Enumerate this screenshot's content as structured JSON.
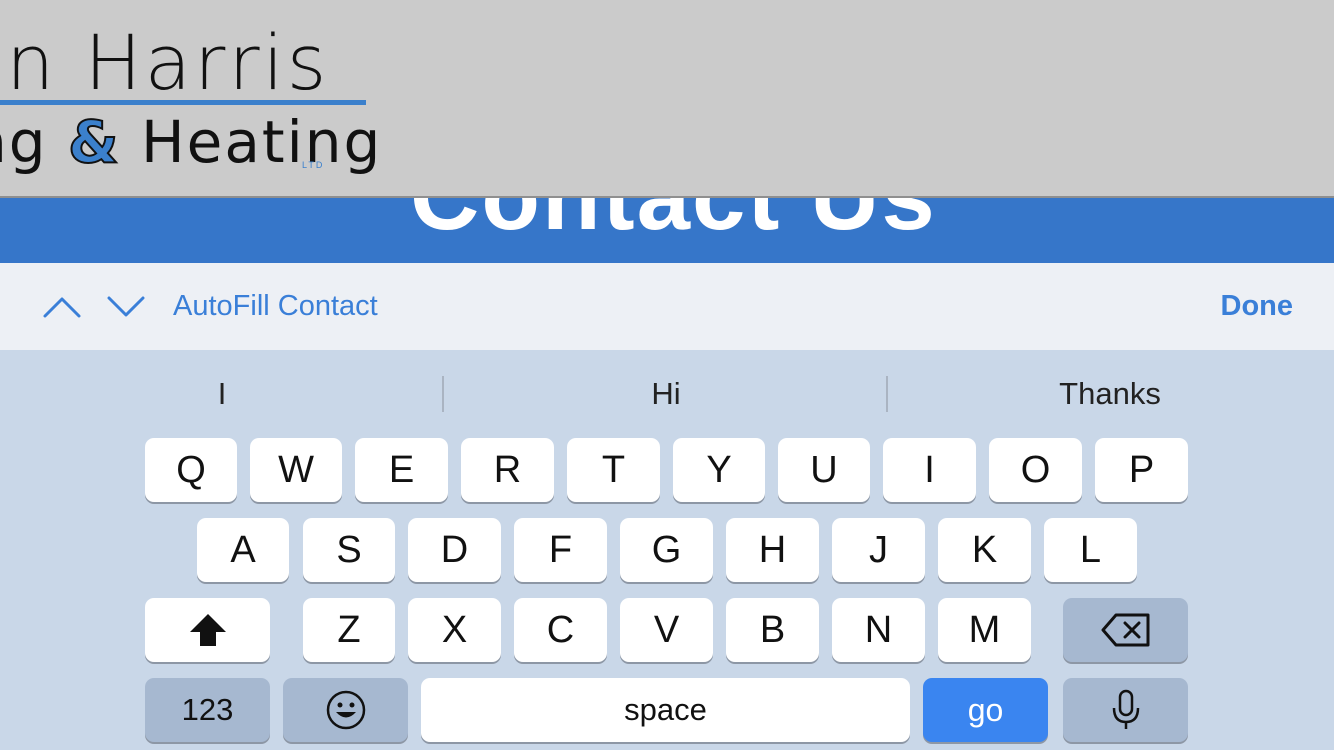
{
  "web_page": {
    "logo": {
      "line1": "in Harris",
      "line2_part_a": "ng ",
      "line2_amp": "&",
      "line2_part_b": " Heating",
      "ltd": "LTD"
    },
    "section_title": "Contact Us"
  },
  "accessory_bar": {
    "autofill_label": "AutoFill Contact",
    "done_label": "Done"
  },
  "keyboard": {
    "predictions": [
      "I",
      "Hi",
      "Thanks"
    ],
    "row1": [
      "Q",
      "W",
      "E",
      "R",
      "T",
      "Y",
      "U",
      "I",
      "O",
      "P"
    ],
    "row2": [
      "A",
      "S",
      "D",
      "F",
      "G",
      "H",
      "J",
      "K",
      "L"
    ],
    "row3": [
      "Z",
      "X",
      "C",
      "V",
      "B",
      "N",
      "M"
    ],
    "numbers_label": "123",
    "space_label": "space",
    "go_label": "go"
  },
  "colors": {
    "accent": "#3a7fd8",
    "band": "#3676c9",
    "go_key": "#3a85f0"
  }
}
